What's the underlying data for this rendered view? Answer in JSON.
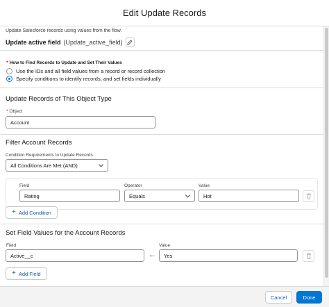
{
  "modal": {
    "title": "Edit Update Records"
  },
  "element": {
    "intro": "Update Salesforce records using values from the flow.",
    "label": "Update active field",
    "api_name": "(Update_active_field)"
  },
  "how_to_find": {
    "label": "How to Find Records to Update and Set Their Values",
    "required_mark": "*",
    "options": [
      {
        "label": "Use the IDs and all field values from a record or record collection",
        "selected": false
      },
      {
        "label": "Specify conditions to identify records, and set fields individually",
        "selected": true
      }
    ]
  },
  "object_section": {
    "title": "Update Records of This Object Type",
    "object_label": "Object",
    "required_mark": "*",
    "object_value": "Account"
  },
  "filter_section": {
    "title": "Filter Account Records",
    "requirement_label": "Condition Requirements to Update Records",
    "requirement_value": "All Conditions Are Met (AND)",
    "columns": {
      "field": "Field",
      "operator": "Operator",
      "value": "Value"
    },
    "conditions": [
      {
        "field": "Rating",
        "operator": "Equals",
        "value": "Hot"
      }
    ],
    "add_button": "Add Condition"
  },
  "set_values_section": {
    "title": "Set Field Values for the Account Records",
    "columns": {
      "field": "Field",
      "value": "Value"
    },
    "rows": [
      {
        "field": "Active__c",
        "arrow": "←",
        "value": "Yes"
      }
    ],
    "add_button": "Add Field"
  },
  "footer": {
    "cancel": "Cancel",
    "done": "Done"
  },
  "icons": [
    "pencil-icon",
    "chevron-down-icon",
    "trash-icon",
    "plus-icon",
    "left-arrow-icon"
  ],
  "colors": {
    "brand": "#0176d3",
    "link": "#0b5cab",
    "required": "#ba0517"
  }
}
